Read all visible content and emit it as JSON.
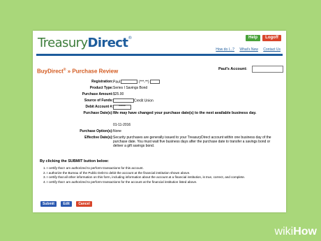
{
  "header": {
    "logo_part1": "Treasury",
    "logo_part2": "Direct",
    "logo_tm": "®",
    "help_label": "Help",
    "logoff_label": "Logoff",
    "links": [
      "How do I...?",
      "What's New",
      "Contact Us"
    ]
  },
  "review": {
    "brand": "BuyDirect",
    "brand_reg": "®",
    "arrow": " » ",
    "title": "Purchase Review",
    "account_label": "Paul's Account:"
  },
  "fields": [
    {
      "label": "Registration:",
      "value": "Paul",
      "extra": "(***-**)"
    },
    {
      "label": "Product Type:",
      "value": "Series I Savings Bond"
    },
    {
      "label": "Purchase Amount:",
      "value": "$25.00"
    },
    {
      "label": "Source of Funds:",
      "value": "Credit Union"
    },
    {
      "label": "Debit Account #:",
      "value": "*****"
    },
    {
      "label": "Purchase Date(s):",
      "value": "We may have changed your purchase date(s) to the next available business day."
    },
    {
      "label": "",
      "value": "01-11-2016"
    },
    {
      "label": "Purchase Option(s):",
      "value": "None"
    },
    {
      "label": "Effective Date(s):",
      "value": "Security purchases are generally issued to your TreasuryDirect account within one business day of the purchase date. You must wait five business days after the purchase date to transfer a savings bond or deliver a gift savings bond."
    }
  ],
  "agreement": {
    "heading": "By clicking the SUBMIT button below:",
    "items": [
      "1.  I certify that I am authorized to perform transactions for this account.",
      "2.  I authorize the Bureau of the Public Debt to debit the account at the financial institution shown above.",
      "3.  I certify that all other information on this form, including information about the account at a financial institution, is true, correct, and complete.",
      "4.  I certify that I am authorized to perform transactions for the account at the financial institution listed above."
    ]
  },
  "actions": {
    "submit": "Submit",
    "edit": "Edit",
    "cancel": "Cancel"
  },
  "watermark": {
    "wiki": "wiki",
    "how": "How"
  }
}
